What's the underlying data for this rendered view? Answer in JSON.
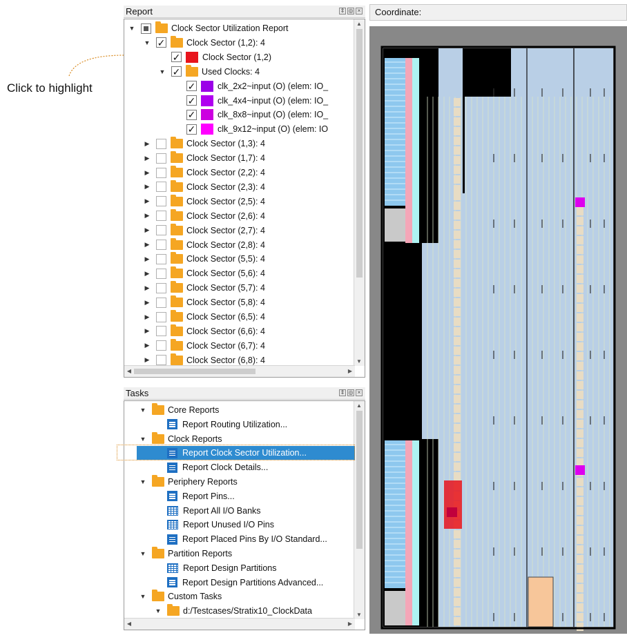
{
  "annotation": {
    "text": "Click to highlight"
  },
  "report_panel": {
    "title": "Report",
    "tree": [
      {
        "label": "Clock Sector Utilization Report",
        "level": 0,
        "arrow": "down",
        "check": "partial",
        "icon": "folder"
      },
      {
        "label": "Clock Sector (1,2): 4",
        "level": 1,
        "arrow": "down",
        "check": "checked",
        "icon": "folder"
      },
      {
        "label": "Clock Sector (1,2)",
        "level": 2,
        "arrow": "none",
        "check": "checked",
        "icon": "swatch",
        "color": "#e8141c"
      },
      {
        "label": "Used Clocks: 4",
        "level": 2,
        "arrow": "down",
        "check": "checked",
        "icon": "folder"
      },
      {
        "label": "clk_2x2~input (O) (elem: IO_",
        "level": 3,
        "arrow": "none",
        "check": "checked",
        "icon": "swatch",
        "color": "#9b00e8"
      },
      {
        "label": "clk_4x4~input (O) (elem: IO_",
        "level": 3,
        "arrow": "none",
        "check": "checked",
        "icon": "swatch",
        "color": "#b000f0"
      },
      {
        "label": "clk_8x8~input (O) (elem: IO_",
        "level": 3,
        "arrow": "none",
        "check": "checked",
        "icon": "swatch",
        "color": "#cc00e0"
      },
      {
        "label": "clk_9x12~input (O) (elem: IO",
        "level": 3,
        "arrow": "none",
        "check": "checked",
        "icon": "swatch",
        "color": "#ff00ff"
      },
      {
        "label": "Clock Sector (1,3): 4",
        "level": 1,
        "arrow": "right",
        "check": "empty",
        "icon": "folder"
      },
      {
        "label": "Clock Sector (1,7): 4",
        "level": 1,
        "arrow": "right",
        "check": "empty",
        "icon": "folder"
      },
      {
        "label": "Clock Sector (2,2): 4",
        "level": 1,
        "arrow": "right",
        "check": "empty",
        "icon": "folder"
      },
      {
        "label": "Clock Sector (2,3): 4",
        "level": 1,
        "arrow": "right",
        "check": "empty",
        "icon": "folder"
      },
      {
        "label": "Clock Sector (2,5): 4",
        "level": 1,
        "arrow": "right",
        "check": "empty",
        "icon": "folder"
      },
      {
        "label": "Clock Sector (2,6): 4",
        "level": 1,
        "arrow": "right",
        "check": "empty",
        "icon": "folder"
      },
      {
        "label": "Clock Sector (2,7): 4",
        "level": 1,
        "arrow": "right",
        "check": "empty",
        "icon": "folder"
      },
      {
        "label": "Clock Sector (2,8): 4",
        "level": 1,
        "arrow": "right",
        "check": "empty",
        "icon": "folder"
      },
      {
        "label": "Clock Sector (5,5): 4",
        "level": 1,
        "arrow": "right",
        "check": "empty",
        "icon": "folder"
      },
      {
        "label": "Clock Sector (5,6): 4",
        "level": 1,
        "arrow": "right",
        "check": "empty",
        "icon": "folder"
      },
      {
        "label": "Clock Sector (5,7): 4",
        "level": 1,
        "arrow": "right",
        "check": "empty",
        "icon": "folder"
      },
      {
        "label": "Clock Sector (5,8): 4",
        "level": 1,
        "arrow": "right",
        "check": "empty",
        "icon": "folder"
      },
      {
        "label": "Clock Sector (6,5): 4",
        "level": 1,
        "arrow": "right",
        "check": "empty",
        "icon": "folder"
      },
      {
        "label": "Clock Sector (6,6): 4",
        "level": 1,
        "arrow": "right",
        "check": "empty",
        "icon": "folder"
      },
      {
        "label": "Clock Sector (6,7): 4",
        "level": 1,
        "arrow": "right",
        "check": "empty",
        "icon": "folder"
      },
      {
        "label": "Clock Sector (6,8): 4",
        "level": 1,
        "arrow": "right",
        "check": "empty",
        "icon": "folder"
      }
    ]
  },
  "tasks_panel": {
    "title": "Tasks",
    "tree": [
      {
        "label": "Core Reports",
        "level": 0,
        "arrow": "down",
        "icon": "folder"
      },
      {
        "label": "Report Routing Utilization...",
        "level": 1,
        "arrow": "none",
        "icon": "doc"
      },
      {
        "label": "Clock Reports",
        "level": 0,
        "arrow": "down",
        "icon": "folder"
      },
      {
        "label": "Report Clock Sector Utilization...",
        "level": 1,
        "arrow": "none",
        "icon": "doc",
        "selected": true
      },
      {
        "label": "Report Clock Details...",
        "level": 1,
        "arrow": "none",
        "icon": "doc"
      },
      {
        "label": "Periphery Reports",
        "level": 0,
        "arrow": "down",
        "icon": "folder"
      },
      {
        "label": "Report Pins...",
        "level": 1,
        "arrow": "none",
        "icon": "doc"
      },
      {
        "label": "Report All I/O Banks",
        "level": 1,
        "arrow": "none",
        "icon": "table"
      },
      {
        "label": "Report Unused I/O Pins",
        "level": 1,
        "arrow": "none",
        "icon": "table"
      },
      {
        "label": "Report Placed Pins By I/O Standard...",
        "level": 1,
        "arrow": "none",
        "icon": "doc"
      },
      {
        "label": "Partition Reports",
        "level": 0,
        "arrow": "down",
        "icon": "folder"
      },
      {
        "label": "Report Design Partitions",
        "level": 1,
        "arrow": "none",
        "icon": "table"
      },
      {
        "label": "Report Design Partitions Advanced...",
        "level": 1,
        "arrow": "none",
        "icon": "doc"
      },
      {
        "label": "Custom Tasks",
        "level": 0,
        "arrow": "down",
        "icon": "folder"
      },
      {
        "label": "d:/Testcases/Stratix10_ClockData",
        "level": 1,
        "arrow": "down",
        "icon": "folder"
      }
    ]
  },
  "chip_view": {
    "title": "Coordinate:",
    "colors": {
      "fabric": "#b9cfe6",
      "black": "#000000",
      "io_pink": "#f4a6b8",
      "io_cyan": "#aef2f2",
      "clock_sector": "#e8141c",
      "clock_region": "#dd00ee"
    }
  }
}
